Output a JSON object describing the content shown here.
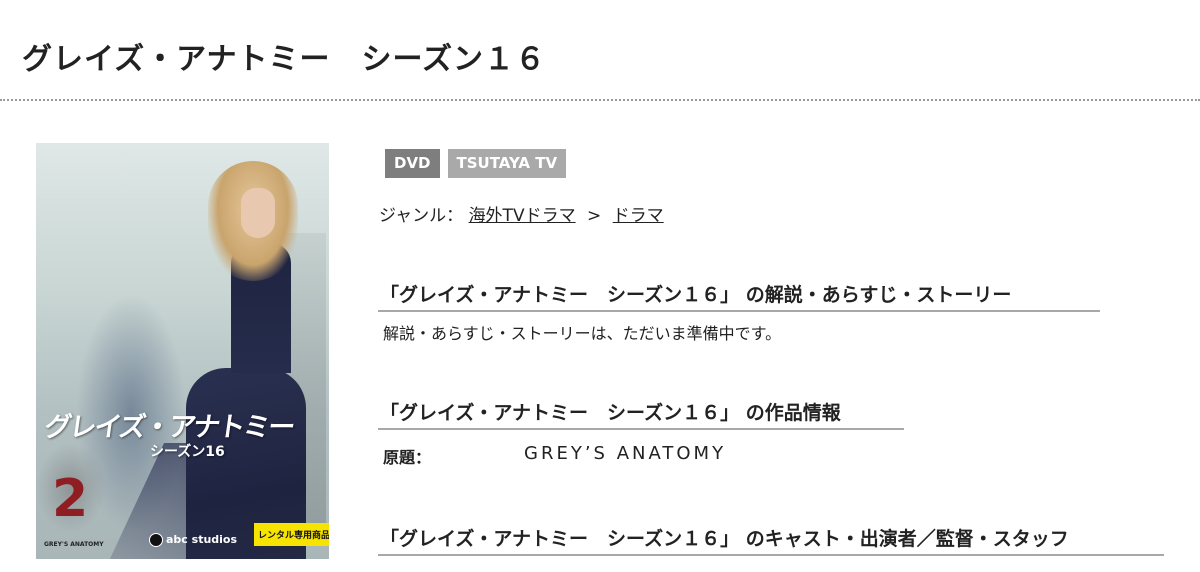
{
  "page": {
    "title": "グレイズ・アナトミー　シーズン１６"
  },
  "poster": {
    "title": "グレイズ・アナトミー",
    "subtitle": "シーズン16",
    "volume": "2",
    "studio": "abc studios",
    "small_logo": "GREY'S ANATOMY",
    "rental_label": "レンタル専用商品"
  },
  "badges": {
    "dvd": "DVD",
    "tsutaya": "TSUTAYA TV"
  },
  "genre": {
    "label": "ジャンル：",
    "parent": "海外TVドラマ",
    "separator": ">",
    "child": "ドラマ"
  },
  "sections": {
    "synopsis_heading": "「グレイズ・アナトミー　シーズン１６」 の解説・あらすじ・ストーリー",
    "synopsis_text": "解説・あらすじ・ストーリーは、ただいま準備中です。",
    "info_heading": "「グレイズ・アナトミー　シーズン１６」 の作品情報",
    "original_title_label": "原題：",
    "original_title_value": "GREY’S ANATOMY",
    "cast_heading": "「グレイズ・アナトミー　シーズン１６」 のキャスト・出演者／監督・スタッフ"
  },
  "colors": {
    "dvd_badge": "#7e7e7e",
    "tsutaya_badge": "#a9a9a9",
    "rental_label_bg": "#f6e400",
    "volume_number": "#8f1e22"
  }
}
